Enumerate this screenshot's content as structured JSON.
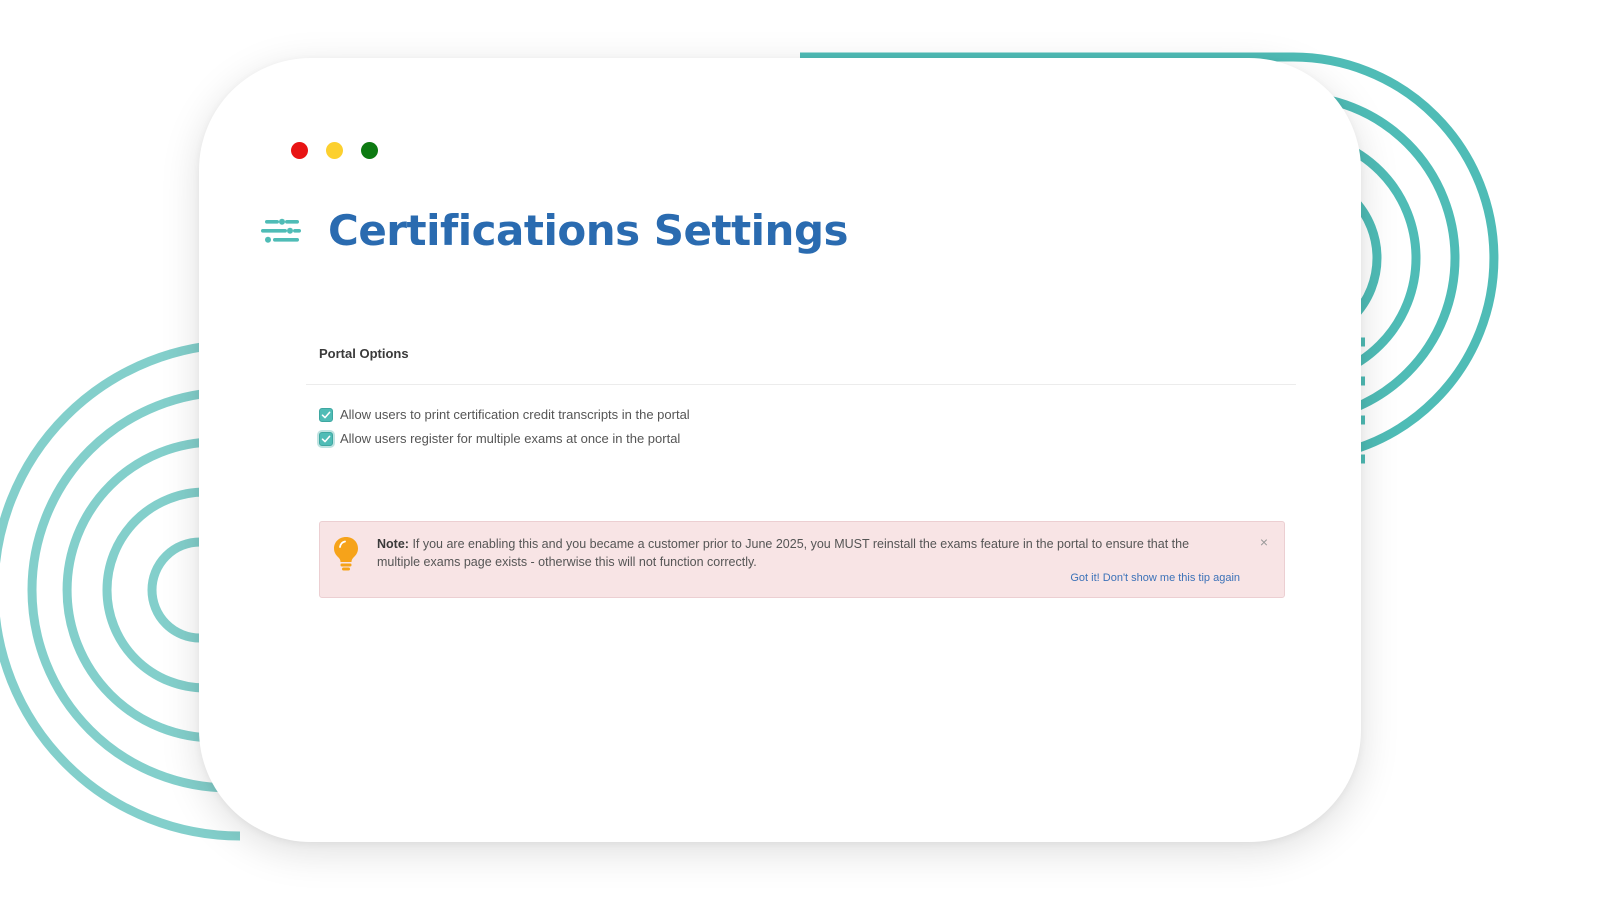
{
  "window": {
    "controls": [
      {
        "name": "close",
        "color": "#e81414"
      },
      {
        "name": "minimize",
        "color": "#fcd02f"
      },
      {
        "name": "maximize",
        "color": "#0d7a12"
      }
    ]
  },
  "header": {
    "icon": "settings-sliders-icon",
    "title": "Certifications Settings"
  },
  "portal_options": {
    "title": "Portal Options",
    "options": [
      {
        "label": "Allow users to print certification credit transcripts in the portal",
        "checked": true
      },
      {
        "label": "Allow users register for multiple exams at once in the portal",
        "checked": true
      }
    ]
  },
  "note": {
    "icon": "lightbulb-icon",
    "label": "Note:",
    "text": "If you are enabling this and you became a customer prior to June 2025, you MUST reinstall the exams feature in the portal to ensure that the multiple exams page exists - otherwise this will not function correctly.",
    "dismiss_link": "Got it! Don't show me this tip again",
    "close_glyph": "×"
  },
  "colors": {
    "accent_teal": "#4fbcb6",
    "title_blue": "#2a6bb0",
    "note_bg": "#f8e4e5",
    "bulb_orange": "#f6a31a",
    "link_blue": "#3c72b8"
  }
}
